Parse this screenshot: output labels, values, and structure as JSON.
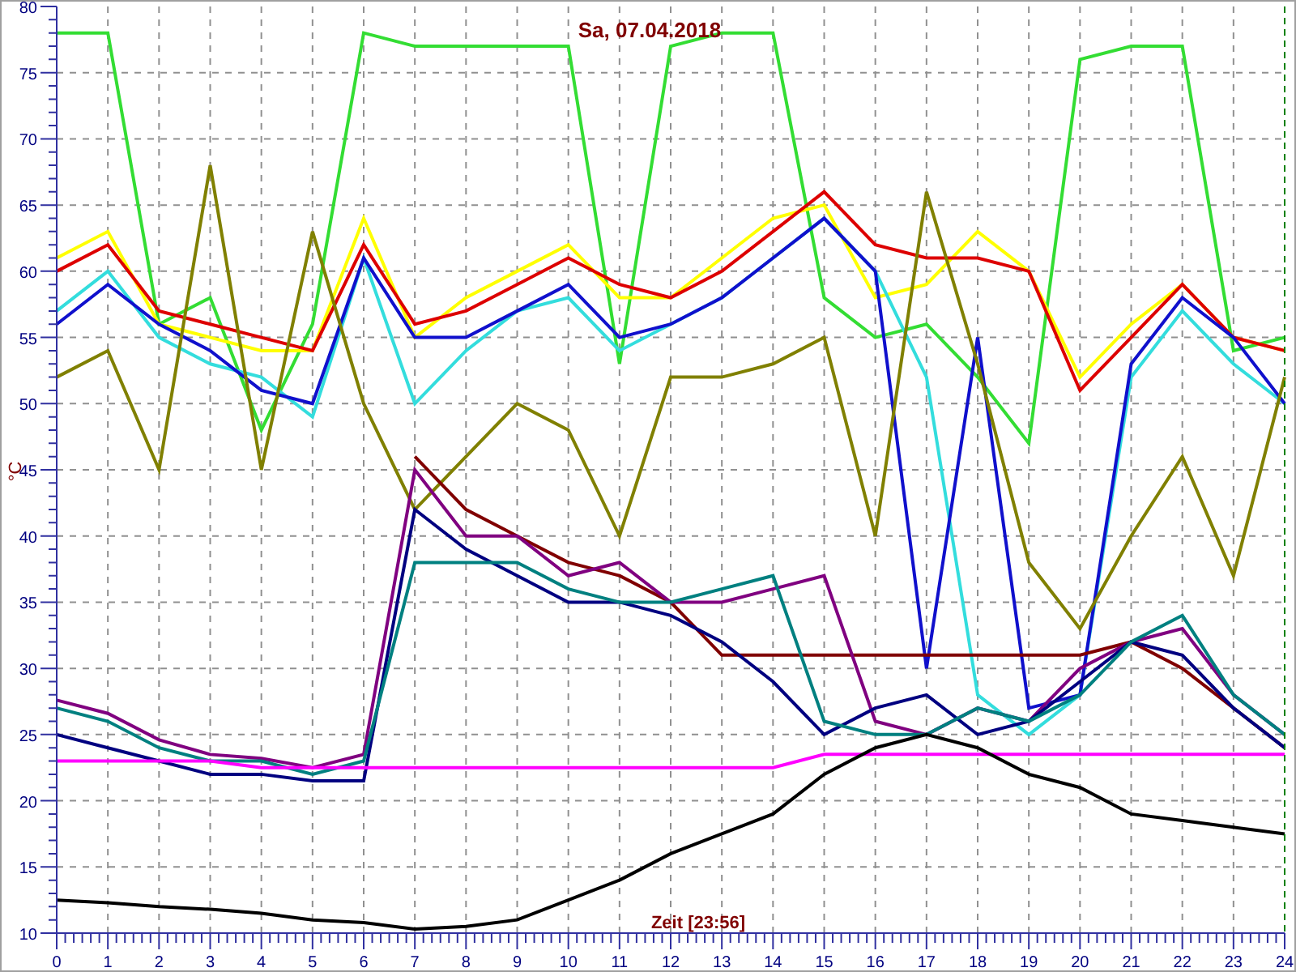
{
  "chart": {
    "title": "Sa, 07.04.2018",
    "time_label": "Zeit [23:56]",
    "chart_data": {
      "type": "line",
      "grid": true,
      "ylabel": "°C",
      "xlim": [
        0,
        24
      ],
      "ylim": [
        10,
        80
      ],
      "xticks": [
        0,
        1,
        2,
        3,
        4,
        5,
        6,
        7,
        8,
        9,
        10,
        11,
        12,
        13,
        14,
        15,
        16,
        17,
        18,
        19,
        20,
        21,
        22,
        23,
        24
      ],
      "yticks": [
        10,
        15,
        20,
        25,
        30,
        35,
        40,
        45,
        50,
        55,
        60,
        65,
        70,
        75,
        80
      ],
      "x": [
        0,
        1,
        2,
        3,
        4,
        5,
        6,
        7,
        8,
        9,
        10,
        11,
        12,
        13,
        14,
        15,
        16,
        17,
        18,
        19,
        20,
        21,
        22,
        23,
        24
      ],
      "series": [
        {
          "color": "#33dd33",
          "values": [
            78,
            78,
            56,
            58,
            48,
            56,
            78,
            77,
            77,
            77,
            77,
            53,
            77,
            78,
            78,
            58,
            55,
            56,
            52,
            47,
            76,
            77,
            77,
            54,
            55
          ]
        },
        {
          "color": "#ffff00",
          "values": [
            61,
            63,
            56,
            55,
            54,
            54,
            64,
            55,
            58,
            60,
            62,
            58,
            58,
            61,
            64,
            65,
            58,
            59,
            63,
            60,
            52,
            56,
            59,
            55,
            54
          ]
        },
        {
          "color": "#dd0000",
          "values": [
            60,
            62,
            57,
            56,
            55,
            54,
            62,
            56,
            57,
            59,
            61,
            59,
            58,
            60,
            63,
            66,
            62,
            61,
            61,
            60,
            51,
            55,
            59,
            55,
            54
          ]
        },
        {
          "color": "#33dddd",
          "values": [
            57,
            60,
            55,
            53,
            52,
            49,
            61,
            50,
            54,
            57,
            58,
            54,
            56,
            58,
            61,
            64,
            60,
            52,
            28,
            25,
            28,
            52,
            57,
            53,
            50
          ]
        },
        {
          "color": "#1010cc",
          "values": [
            56,
            59,
            56,
            54,
            51,
            50,
            61,
            55,
            55,
            57,
            59,
            55,
            56,
            58,
            61,
            64,
            60,
            30,
            55,
            27,
            28,
            53,
            58,
            55,
            50
          ]
        },
        {
          "color": "#808000",
          "values": [
            52,
            54,
            45,
            68,
            45,
            63,
            50,
            42,
            46,
            50,
            48,
            40,
            52,
            52,
            53,
            55,
            40,
            66,
            53,
            38,
            33,
            40,
            46,
            37,
            52
          ]
        },
        {
          "color": "#800000",
          "values": [
            null,
            null,
            null,
            null,
            null,
            null,
            null,
            46,
            42,
            40,
            38,
            37,
            35,
            31,
            31,
            31,
            31,
            31,
            31,
            31,
            31,
            32,
            30,
            27,
            24
          ]
        },
        {
          "color": "#800080",
          "values": [
            27.6,
            26.6,
            24.6,
            23.5,
            23.2,
            22.5,
            23.5,
            45,
            40,
            40,
            37,
            38,
            35,
            35,
            36,
            37,
            26,
            25,
            27,
            26,
            30,
            32,
            33,
            28,
            25
          ]
        },
        {
          "color": "#000080",
          "values": [
            25,
            24,
            23,
            22,
            22,
            21.5,
            21.5,
            42,
            39,
            37,
            35,
            35,
            34,
            32,
            29,
            25,
            27,
            28,
            25,
            26,
            29,
            32,
            31,
            27,
            24
          ]
        },
        {
          "color": "#008080",
          "values": [
            27,
            26,
            24,
            23,
            23,
            22,
            23,
            38,
            38,
            38,
            36,
            35,
            35,
            36,
            37,
            26,
            25,
            25,
            27,
            26,
            28,
            32,
            34,
            28,
            25
          ]
        },
        {
          "color": "#ff00ff",
          "values": [
            23,
            23,
            23,
            23,
            22.5,
            22.5,
            22.5,
            22.5,
            22.5,
            22.5,
            22.5,
            22.5,
            22.5,
            22.5,
            22.5,
            23.5,
            23.5,
            23.5,
            23.5,
            23.5,
            23.5,
            23.5,
            23.5,
            23.5,
            23.5
          ]
        },
        {
          "color": "#000000",
          "values": [
            12.5,
            12.3,
            12,
            11.8,
            11.5,
            11,
            10.8,
            10.3,
            10.5,
            11,
            12.5,
            14,
            16,
            17.5,
            19,
            22,
            24,
            25,
            24,
            22,
            21,
            19,
            18.5,
            18,
            17.5
          ]
        }
      ]
    }
  }
}
